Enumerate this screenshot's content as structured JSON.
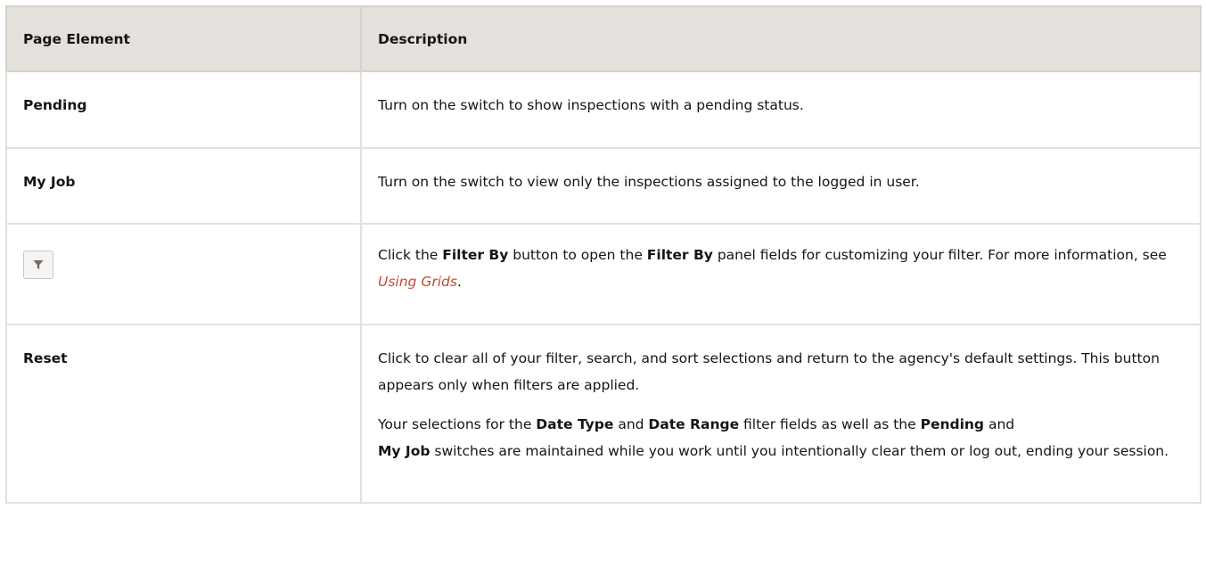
{
  "table": {
    "headers": {
      "element": "Page Element",
      "description": "Description"
    },
    "rows": {
      "pending": {
        "element": "Pending",
        "description": "Turn on the switch to show inspections with a pending status."
      },
      "my_job": {
        "element": "My Job",
        "description": "Turn on the switch to view only the inspections assigned to the logged in user."
      },
      "filter": {
        "element_icon": "filter-icon",
        "desc_prefix": "Click the ",
        "desc_bold_1": "Filter By",
        "desc_mid_1": " button to open the ",
        "desc_bold_2": "Filter By",
        "desc_mid_2": " panel fields for customizing your filter. For more information, see ",
        "desc_link": "Using Grids",
        "desc_suffix": "."
      },
      "reset": {
        "element": "Reset",
        "para1": "Click to clear all of your filter, search, and sort selections and return to the agency's default settings. This button appears only when filters are applied.",
        "para2_prefix": "Your selections for the ",
        "para2_bold_1": "Date Type",
        "para2_mid_1": " and ",
        "para2_bold_2": "Date Range",
        "para2_mid_2": " filter fields as well as the ",
        "para2_bold_3": "Pending",
        "para2_mid_3": " and ",
        "para2_bold_4": "My Job",
        "para2_suffix": " switches are maintained while you work until you intentionally clear them or log out, ending your session."
      }
    }
  },
  "colors": {
    "header_bg": "#e4e1dd",
    "link": "#c74634",
    "text": "#161513"
  }
}
